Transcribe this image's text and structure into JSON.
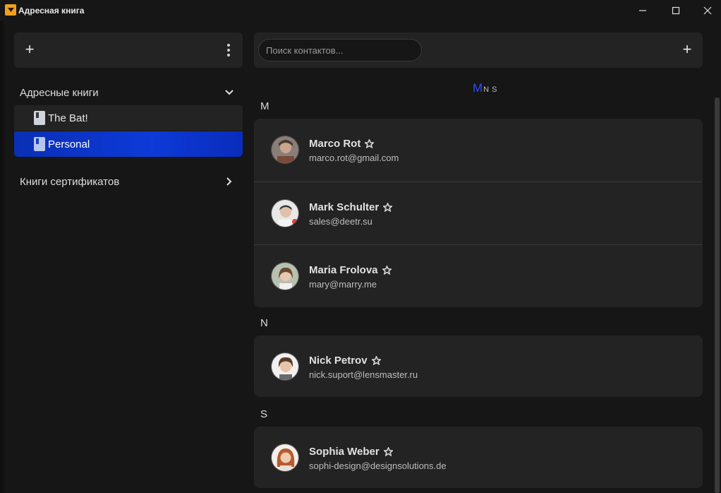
{
  "window": {
    "title": "Адресная книга"
  },
  "sidebar": {
    "address_books_label": "Адресные книги",
    "books": [
      {
        "label": "The Bat!",
        "selected": false
      },
      {
        "label": "Personal",
        "selected": true
      }
    ],
    "cert_books_label": "Книги сертификатов"
  },
  "toolbar": {
    "search_placeholder": "Поиск контактов...",
    "add_symbol": "+"
  },
  "alphabet_index": [
    "M",
    "N",
    "S"
  ],
  "alphabet_active": "M",
  "groups": [
    {
      "letter": "M",
      "contacts": [
        {
          "name": "Marco Rot",
          "email": "marco.rot@gmail.com"
        },
        {
          "name": "Mark Schulter",
          "email": "sales@deetr.su"
        },
        {
          "name": "Maria Frolova",
          "email": "mary@marry.me"
        }
      ]
    },
    {
      "letter": "N",
      "contacts": [
        {
          "name": "Nick Petrov",
          "email": "nick.suport@lensmaster.ru"
        }
      ]
    },
    {
      "letter": "S",
      "contacts": [
        {
          "name": "Sophia Weber",
          "email": "sophi-design@designsolutions.de"
        }
      ]
    }
  ],
  "colors": {
    "accent": "#0d3ad8",
    "index_active": "#2d4ef5",
    "background": "#161616",
    "panel": "#232323"
  }
}
